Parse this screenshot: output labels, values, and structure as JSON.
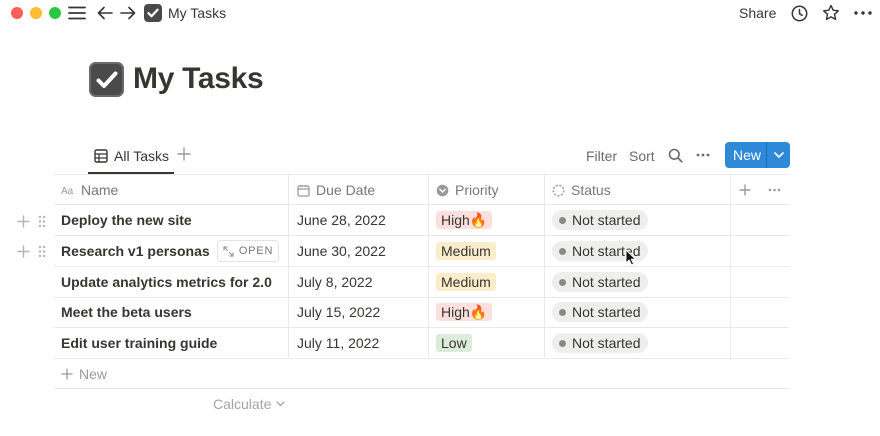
{
  "window": {
    "breadcrumb_title": "My Tasks",
    "share_label": "Share"
  },
  "page": {
    "title": "My Tasks"
  },
  "view": {
    "tab_label": "All Tasks",
    "filter_label": "Filter",
    "sort_label": "Sort",
    "new_button_label": "New"
  },
  "table": {
    "columns": [
      "Name",
      "Due Date",
      "Priority",
      "Status"
    ],
    "rows": [
      {
        "name": "Deploy the new site",
        "due": "June 28, 2022",
        "priority": "High🔥",
        "status": "Not started"
      },
      {
        "name": "Research v1 personas",
        "due": "June 30, 2022",
        "priority": "Medium",
        "status": "Not started"
      },
      {
        "name": "Update analytics metrics for 2.0",
        "due": "July 8, 2022",
        "priority": "Medium",
        "status": "Not started"
      },
      {
        "name": "Meet the beta users",
        "due": "July 15, 2022",
        "priority": "High🔥",
        "status": "Not started"
      },
      {
        "name": "Edit user training guide",
        "due": "July 11, 2022",
        "priority": "Low",
        "status": "Not started"
      }
    ],
    "open_label": "OPEN",
    "new_row_label": "New",
    "calculate_label": "Calculate"
  },
  "colors": {
    "accent": "#2e8ad8",
    "priority_high_bg": "#fde0dd",
    "priority_medium_bg": "#fbeccb",
    "priority_low_bg": "#dcecdb",
    "status_dot": "#8a8985"
  },
  "icons": {
    "menu": "hamburger-icon",
    "back": "arrow-left-icon",
    "forward": "arrow-right-icon",
    "page": "checkbox-icon",
    "history": "clock-icon",
    "favorite": "star-icon",
    "more": "more-dots-icon"
  }
}
